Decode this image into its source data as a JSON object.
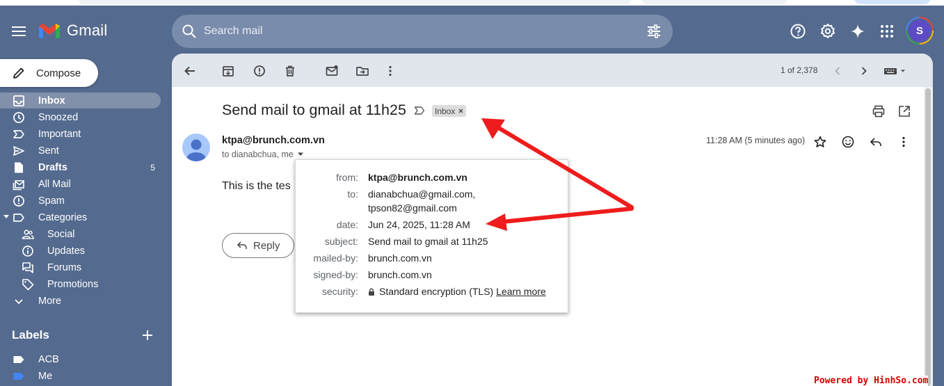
{
  "app": {
    "name": "Gmail"
  },
  "search": {
    "placeholder": "Search mail"
  },
  "header": {
    "avatar_letter": "S"
  },
  "compose": {
    "label": "Compose"
  },
  "sidebar": {
    "items": [
      {
        "label": "Inbox",
        "icon": "inbox-icon",
        "active": true
      },
      {
        "label": "Snoozed",
        "icon": "clock-icon"
      },
      {
        "label": "Important",
        "icon": "important-icon"
      },
      {
        "label": "Sent",
        "icon": "send-icon"
      },
      {
        "label": "Drafts",
        "icon": "draft-icon",
        "count": "5"
      },
      {
        "label": "All Mail",
        "icon": "all-mail-icon"
      },
      {
        "label": "Spam",
        "icon": "spam-icon"
      },
      {
        "label": "Categories",
        "icon": "label-icon"
      },
      {
        "label": "Social",
        "icon": "social-icon"
      },
      {
        "label": "Updates",
        "icon": "info-icon"
      },
      {
        "label": "Forums",
        "icon": "forum-icon"
      },
      {
        "label": "Promotions",
        "icon": "tag-icon"
      },
      {
        "label": "More",
        "icon": "chevron-down-icon"
      }
    ],
    "labels_title": "Labels",
    "labels": [
      {
        "label": "ACB",
        "color": "#ffffff"
      },
      {
        "label": "Me",
        "color": "#4285f4"
      }
    ]
  },
  "toolbar": {
    "pager": "1 of 2,378"
  },
  "message": {
    "subject": "Send mail to gmail at 11h25",
    "chip": "Inbox",
    "sender": "ktpa@brunch.com.vn",
    "to_line": "to dianabchua, me",
    "timestamp": "11:28 AM (5 minutes ago)",
    "body": "This is the tes",
    "reply_label": "Reply"
  },
  "details": {
    "rows": [
      {
        "key": "from:",
        "value": "ktpa@brunch.com.vn"
      },
      {
        "key": "to:",
        "value": "dianabchua@gmail.com,",
        "value2": "tpson82@gmail.com"
      },
      {
        "key": "date:",
        "value": "Jun 24, 2025, 11:28 AM"
      },
      {
        "key": "subject:",
        "value": "Send mail to gmail at 11h25"
      },
      {
        "key": "mailed-by:",
        "value": "brunch.com.vn"
      },
      {
        "key": "signed-by:",
        "value": "brunch.com.vn"
      },
      {
        "key": "security:",
        "value": "Standard encryption (TLS)",
        "link": "Learn more"
      }
    ]
  },
  "watermark": "Powered by HinhSo.com",
  "colors": {
    "background": "#546a8e",
    "annotation_arrow": "#ee1c1c"
  }
}
